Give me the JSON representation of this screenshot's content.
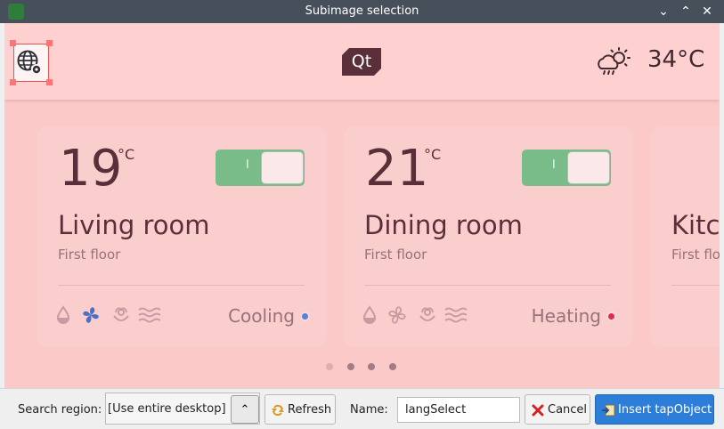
{
  "window": {
    "title": "Subimage selection"
  },
  "app": {
    "outside_temp": "34°C",
    "logo": "Qt",
    "rooms": [
      {
        "temp": "19",
        "unit": "°C",
        "switch_mark": "I",
        "name": "Living room",
        "floor": "First floor",
        "mode": "Cooling",
        "mode_color": "#5c7fd8"
      },
      {
        "temp": "21",
        "unit": "°C",
        "switch_mark": "I",
        "name": "Dining room",
        "floor": "First floor",
        "mode": "Heating",
        "mode_color": "#e12b4c"
      },
      {
        "name": "Kitc",
        "floor": "First flo"
      }
    ],
    "page_count": 4,
    "active_page": 0
  },
  "toolbar": {
    "search_label": "Search region:",
    "search_value": "[Use entire desktop]",
    "refresh_label": "Refresh",
    "name_label": "Name:",
    "name_value": "langSelect",
    "cancel_label": "Cancel",
    "insert_label": "Insert tapObject"
  },
  "colors": {
    "accent": "#2d7ed8",
    "titlebar": "#47505a",
    "canvas": "#fcc9c9"
  }
}
